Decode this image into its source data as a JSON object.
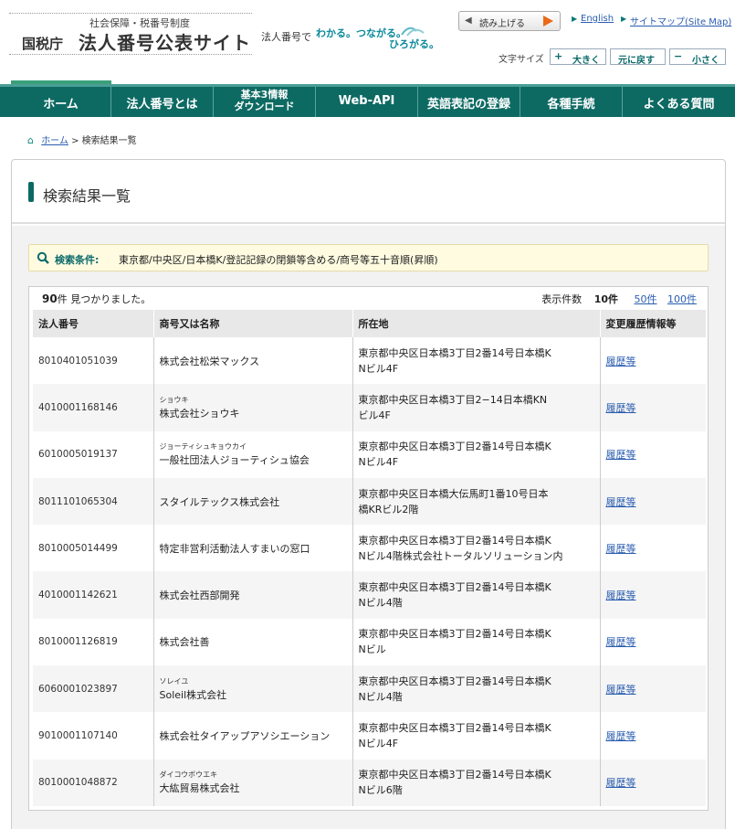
{
  "header": {
    "subtitle": "社会保障・税番号制度",
    "agency": "国税庁",
    "site_name": "法人番号公表サイト",
    "tag_prefix": "法人番号で",
    "tag_words": "わかる。つながる。",
    "tag_words2": "ひろがる。",
    "read_aloud": "読み上げる",
    "english": "English",
    "sitemap": "サイトマップ(Site Map)",
    "font_size_label": "文字サイズ",
    "font_larger": "大きく",
    "font_reset": "元に戻す",
    "font_smaller": "小さく"
  },
  "nav": {
    "home": "ホーム",
    "about": "法人番号とは",
    "download_l1": "基本3情報",
    "download_l2": "ダウンロード",
    "webapi": "Web-API",
    "english_reg": "英語表記の登録",
    "procedures": "各種手続",
    "faq": "よくある質問"
  },
  "breadcrumb": {
    "home": "ホーム",
    "separator": ">",
    "current": "検索結果一覧"
  },
  "page": {
    "title": "検索結果一覧",
    "condition_label": "検索条件:",
    "condition_value": "東京都/中央区/日本橋K/登記記録の閉鎖等含める/商号等五十音順(昇順)",
    "count_num": "90",
    "count_suffix": "件 見つかりました。",
    "perpage_label": "表示件数",
    "perpage_current": "10件",
    "perpage_50": "50件",
    "perpage_100": "100件"
  },
  "table": {
    "headers": [
      "法人番号",
      "商号又は名称",
      "所在地",
      "変更履歴情報等"
    ],
    "history_link": "履歴等",
    "rows": [
      {
        "number": "8010401051039",
        "kana": "",
        "name": "株式会社松栄マックス",
        "addr1": "東京都中央区日本橋3丁目2番14号日本橋K",
        "addr2": "Nビル4F"
      },
      {
        "number": "4010001168146",
        "kana": "ショウキ",
        "name": "株式会社ショウキ",
        "addr1": "東京都中央区日本橋3丁目2−14日本橋KN",
        "addr2": "ビル4F"
      },
      {
        "number": "6010005019137",
        "kana": "ジョーティシュキョウカイ",
        "name": "一般社団法人ジョーティシュ協会",
        "addr1": "東京都中央区日本橋3丁目2番14号日本橋K",
        "addr2": "Nビル4F"
      },
      {
        "number": "8011101065304",
        "kana": "",
        "name": "スタイルテックス株式会社",
        "addr1": "東京都中央区日本橋大伝馬町1番10号日本",
        "addr2": "橋KRビル2階"
      },
      {
        "number": "8010005014499",
        "kana": "",
        "name": "特定非営利活動法人すまいの窓口",
        "addr1": "東京都中央区日本橋3丁目2番14号日本橋K",
        "addr2": "Nビル4階株式会社トータルソリューション内"
      },
      {
        "number": "4010001142621",
        "kana": "",
        "name": "株式会社西部開発",
        "addr1": "東京都中央区日本橋3丁目2番14号日本橋K",
        "addr2": "Nビル4階"
      },
      {
        "number": "8010001126819",
        "kana": "",
        "name": "株式会社善",
        "addr1": "東京都中央区日本橋3丁目2番14号日本橋K",
        "addr2": "Nビル"
      },
      {
        "number": "6060001023897",
        "kana": "ソレイユ",
        "name": "Soleil株式会社",
        "addr1": "東京都中央区日本橋3丁目2番14号日本橋K",
        "addr2": "Nビル4階"
      },
      {
        "number": "9010001107140",
        "kana": "",
        "name": "株式会社タイアップアソシエーション",
        "addr1": "東京都中央区日本橋3丁目2番14号日本橋K",
        "addr2": "Nビル4F"
      },
      {
        "number": "8010001048872",
        "kana": "ダイコウボウエキ",
        "name": "大紘貿易株式会社",
        "addr1": "東京都中央区日本橋3丁目2番14号日本橋K",
        "addr2": "Nビル6階"
      }
    ]
  }
}
